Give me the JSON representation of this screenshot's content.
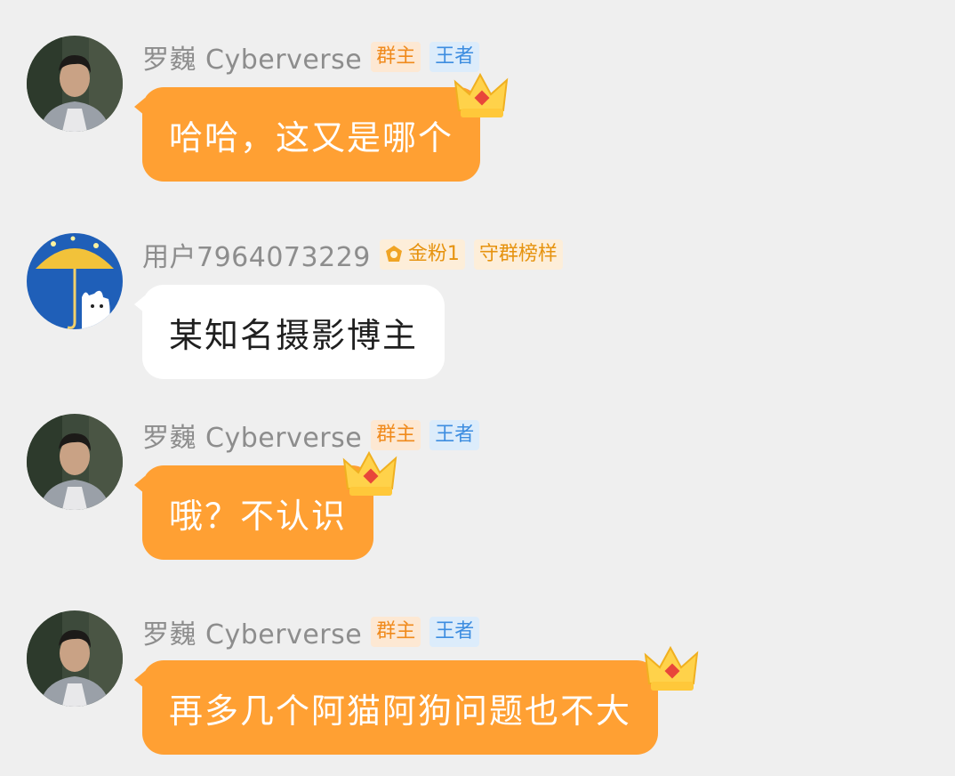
{
  "messages": [
    {
      "sender": "罗巍 Cyberverse",
      "badges": [
        "群主",
        "王者"
      ],
      "text": "哈哈，这又是哪个",
      "style": "orange",
      "avatar": "man-portrait"
    },
    {
      "sender": "用户7964073229",
      "badges": [
        "金粉1",
        "守群榜样"
      ],
      "text": "某知名摄影博主",
      "style": "white",
      "avatar": "cat-umbrella"
    },
    {
      "sender": "罗巍 Cyberverse",
      "badges": [
        "群主",
        "王者"
      ],
      "text": "哦？不认识",
      "style": "orange",
      "avatar": "man-portrait"
    },
    {
      "sender": "罗巍 Cyberverse",
      "badges": [
        "群主",
        "王者"
      ],
      "text": "再多几个阿猫阿狗问题也不大",
      "style": "orange",
      "avatar": "man-portrait"
    }
  ],
  "colors": {
    "background": "#efefef",
    "bubble_orange": "#ffa033",
    "bubble_white": "#ffffff",
    "name_gray": "#8d8d8d",
    "owner_badge": "#f08a1c",
    "king_badge": "#3d8de0"
  }
}
